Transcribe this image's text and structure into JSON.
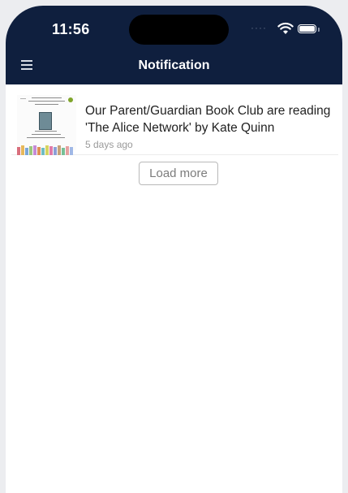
{
  "status_bar": {
    "time": "11:56",
    "signal_icon": "signal-dots-icon",
    "wifi_icon": "wifi-icon",
    "battery_icon": "battery-icon"
  },
  "header": {
    "menu_icon": "hamburger-menu-icon",
    "title": "Notification",
    "background": "#0f1f3e"
  },
  "notifications": [
    {
      "text": "Our Parent/Guardian Book Club are reading 'The Alice Network' by Kate Quinn",
      "time": "5 days ago",
      "thumbnail_icon": "book-club-poster-thumbnail"
    }
  ],
  "load_more": {
    "label": "Load more"
  }
}
